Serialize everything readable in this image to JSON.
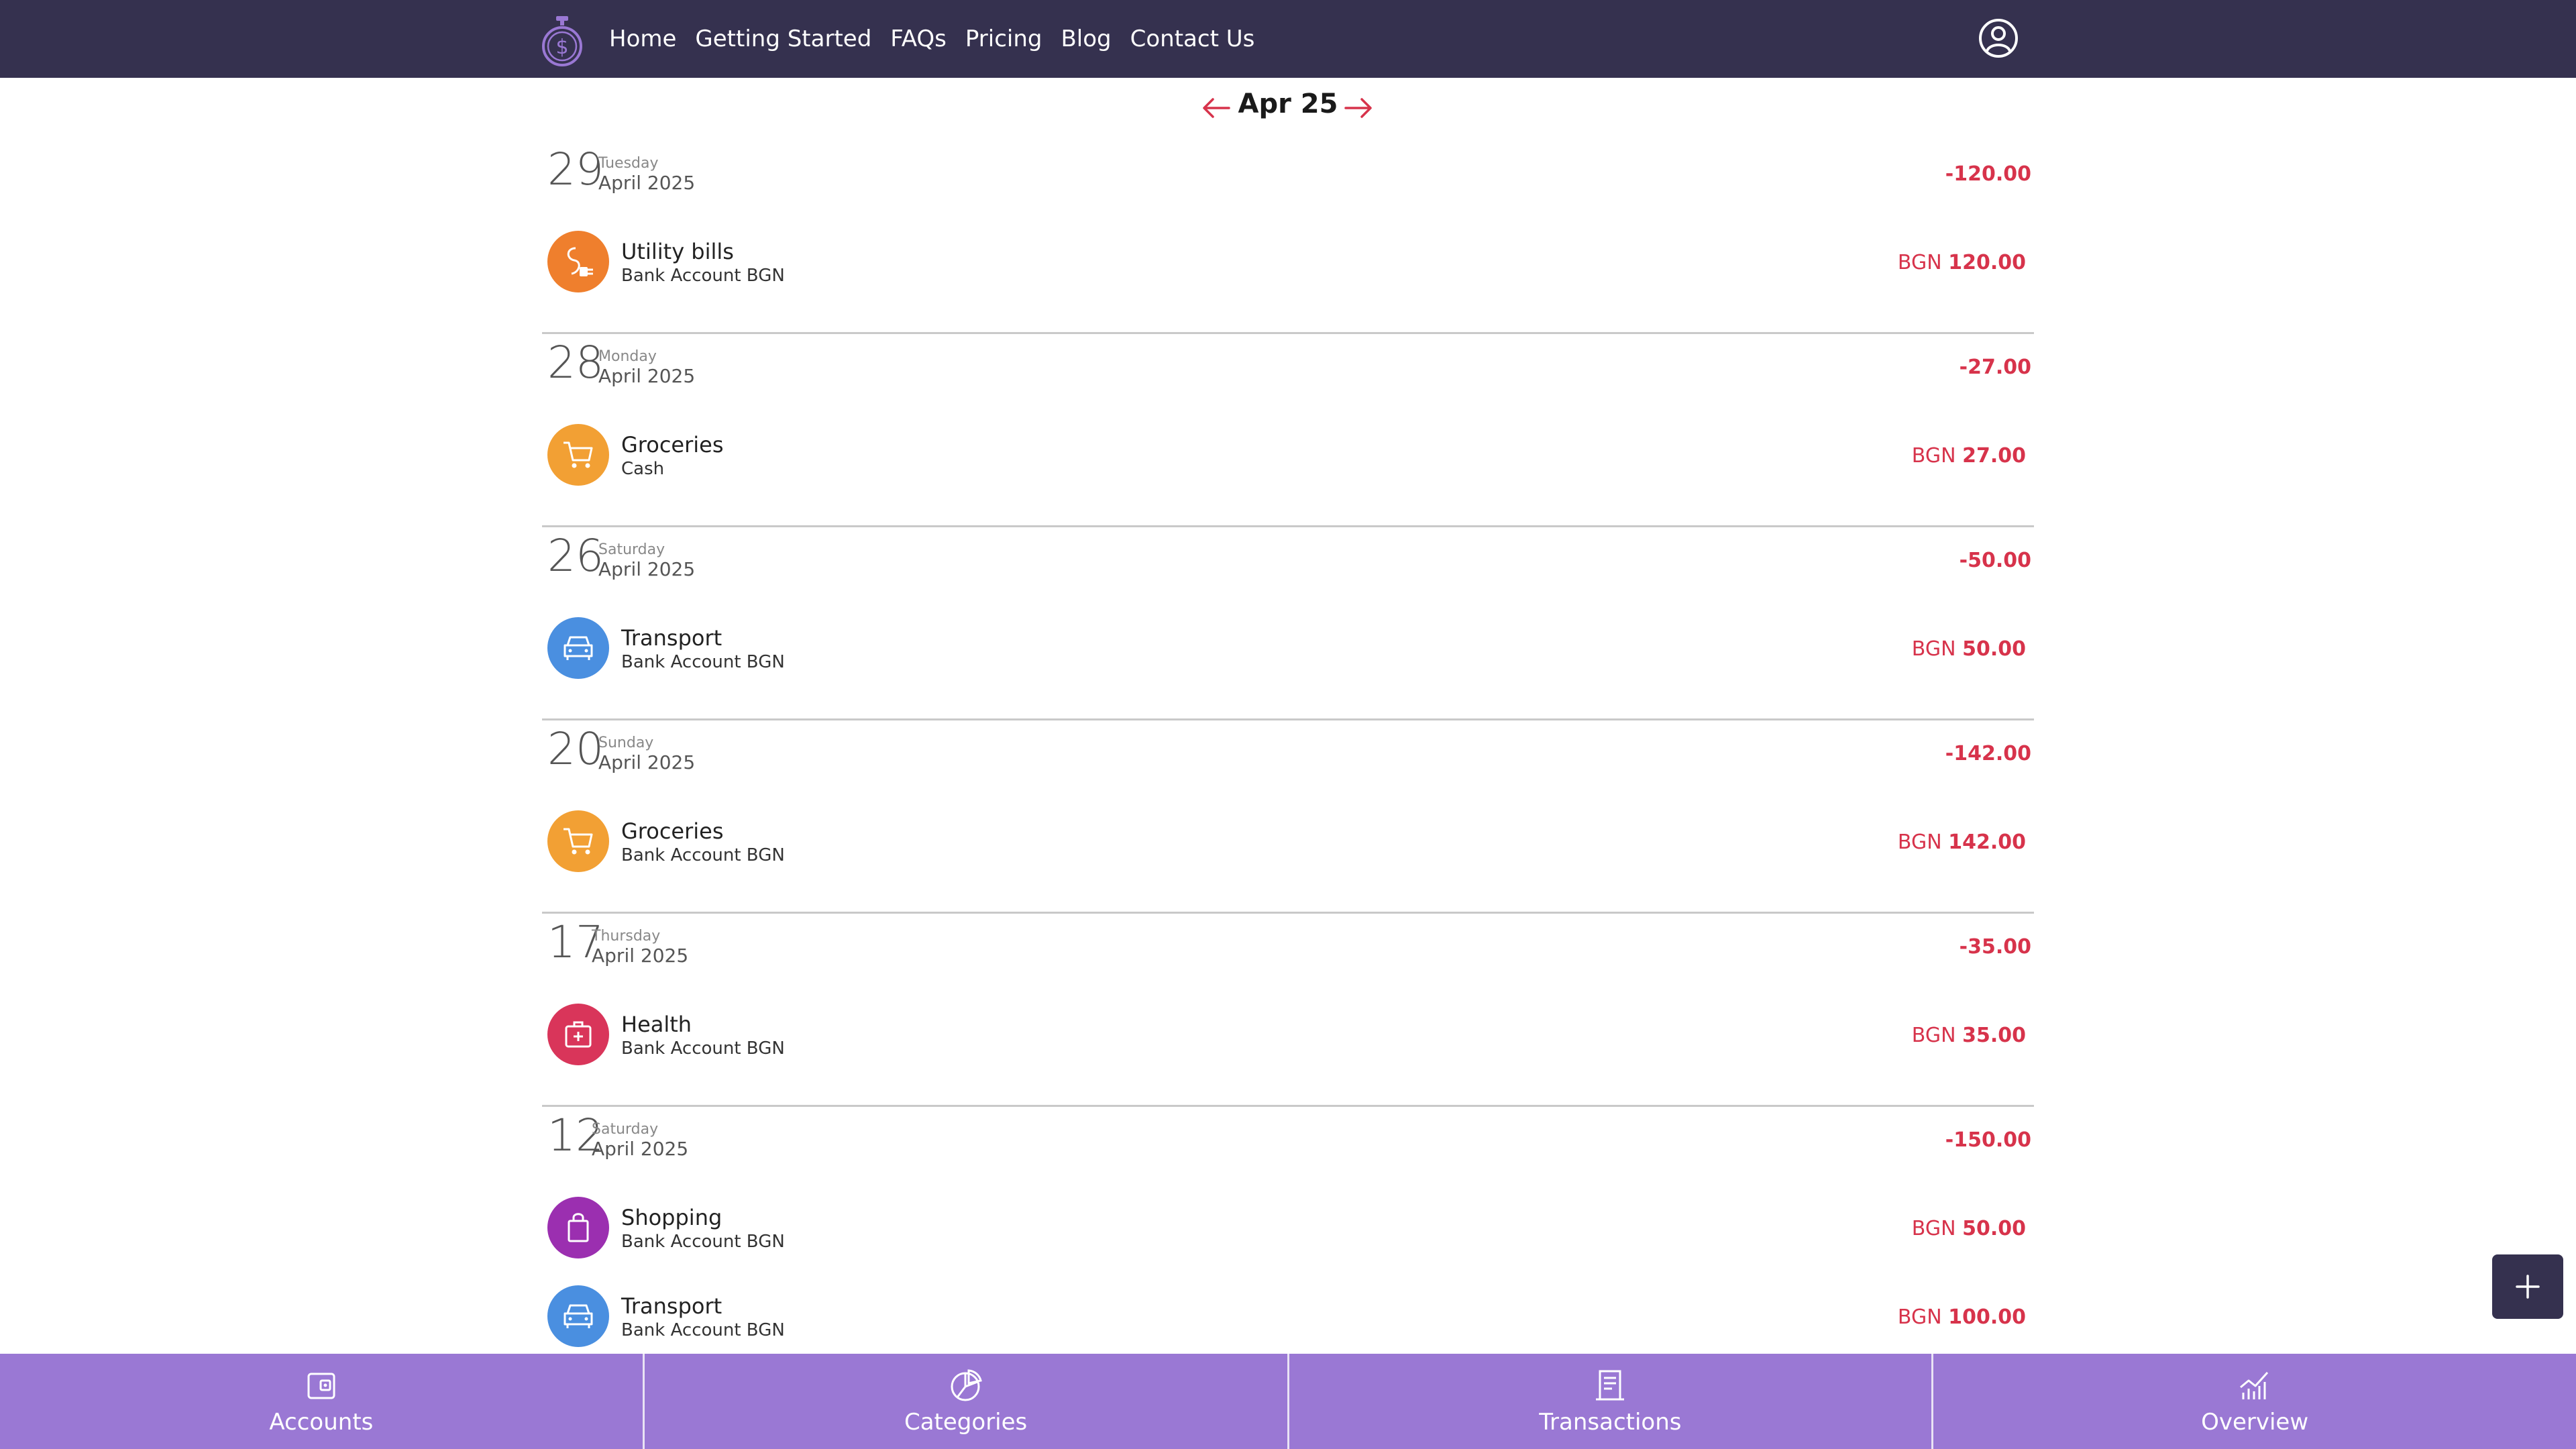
{
  "nav": {
    "links": [
      "Home",
      "Getting Started",
      "FAQs",
      "Pricing",
      "Blog",
      "Contact Us"
    ],
    "logo_icon": "stopwatch-dollar-icon",
    "user_icon": "user-circle-icon"
  },
  "month": {
    "label": "Apr 25",
    "prev_icon": "arrow-left-icon",
    "next_icon": "arrow-right-icon"
  },
  "days": [
    {
      "day": "29",
      "weekday": "Tuesday",
      "month_year": "April 2025",
      "total": "-120.00",
      "transactions": [
        {
          "category": "Utility bills",
          "account": "Bank Account BGN",
          "currency": "BGN",
          "amount": "120.00",
          "icon": "plug-icon",
          "color": "#ef7f2d"
        }
      ]
    },
    {
      "day": "28",
      "weekday": "Monday",
      "month_year": "April 2025",
      "total": "-27.00",
      "transactions": [
        {
          "category": "Groceries",
          "account": "Cash",
          "currency": "BGN",
          "amount": "27.00",
          "icon": "cart-icon",
          "color": "#f2a034"
        }
      ]
    },
    {
      "day": "26",
      "weekday": "Saturday",
      "month_year": "April 2025",
      "total": "-50.00",
      "transactions": [
        {
          "category": "Transport",
          "account": "Bank Account BGN",
          "currency": "BGN",
          "amount": "50.00",
          "icon": "car-icon",
          "color": "#4a8fe0"
        }
      ]
    },
    {
      "day": "20",
      "weekday": "Sunday",
      "month_year": "April 2025",
      "total": "-142.00",
      "transactions": [
        {
          "category": "Groceries",
          "account": "Bank Account BGN",
          "currency": "BGN",
          "amount": "142.00",
          "icon": "cart-icon",
          "color": "#f2a034"
        }
      ]
    },
    {
      "day": "17",
      "weekday": "Thursday",
      "month_year": "April 2025",
      "total": "-35.00",
      "transactions": [
        {
          "category": "Health",
          "account": "Bank Account BGN",
          "currency": "BGN",
          "amount": "35.00",
          "icon": "first-aid-icon",
          "color": "#d9355a"
        }
      ]
    },
    {
      "day": "12",
      "weekday": "Saturday",
      "month_year": "April 2025",
      "total": "-150.00",
      "transactions": [
        {
          "category": "Shopping",
          "account": "Bank Account BGN",
          "currency": "BGN",
          "amount": "50.00",
          "icon": "shopping-bag-icon",
          "color": "#9b2fb0"
        },
        {
          "category": "Transport",
          "account": "Bank Account BGN",
          "currency": "BGN",
          "amount": "100.00",
          "icon": "car-icon",
          "color": "#4a8fe0"
        }
      ]
    }
  ],
  "fab": {
    "icon": "plus-icon"
  },
  "bottom_nav": [
    {
      "label": "Accounts",
      "icon": "wallet-icon"
    },
    {
      "label": "Categories",
      "icon": "pie-chart-icon"
    },
    {
      "label": "Transactions",
      "icon": "receipt-icon"
    },
    {
      "label": "Overview",
      "icon": "line-chart-icon"
    }
  ],
  "colors": {
    "topbar": "#35314f",
    "bottombar": "#9a78d4",
    "expense": "#d7334b"
  }
}
